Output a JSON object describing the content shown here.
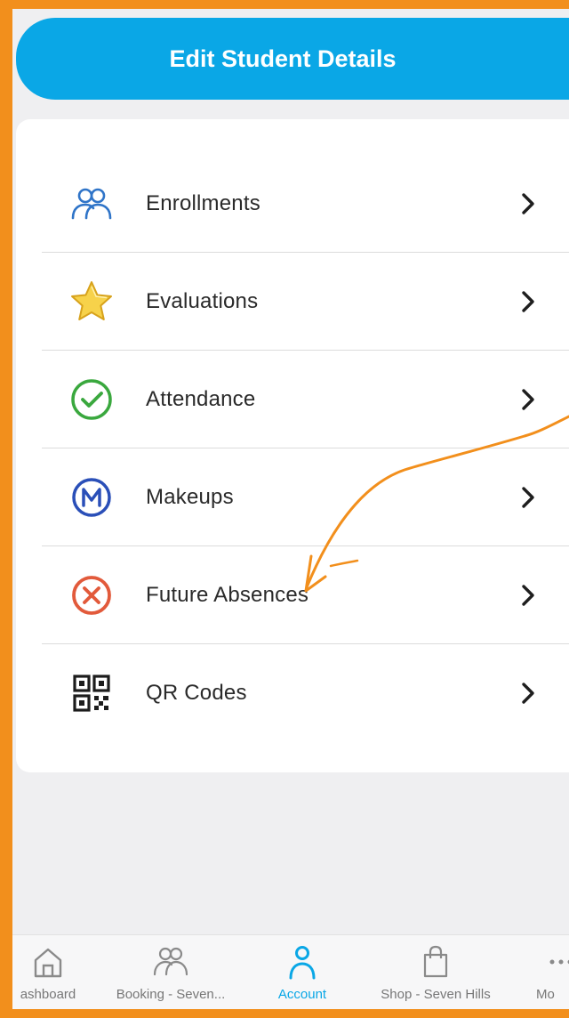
{
  "header": {
    "title": "Edit Student Details"
  },
  "menu": {
    "items": [
      {
        "label": "Enrollments",
        "icon": "people-icon"
      },
      {
        "label": "Evaluations",
        "icon": "star-icon"
      },
      {
        "label": "Attendance",
        "icon": "check-circle-icon"
      },
      {
        "label": "Makeups",
        "icon": "makeup-m-icon"
      },
      {
        "label": "Future Absences",
        "icon": "x-circle-icon"
      },
      {
        "label": "QR Codes",
        "icon": "qr-code-icon"
      }
    ]
  },
  "tabbar": {
    "tabs": [
      {
        "label": "ashboard",
        "icon": "home-icon",
        "active": false
      },
      {
        "label": "Booking - Seven...",
        "icon": "people-icon",
        "active": false
      },
      {
        "label": "Account",
        "icon": "person-icon",
        "active": true
      },
      {
        "label": "Shop - Seven Hills",
        "icon": "shopping-bag-icon",
        "active": false
      },
      {
        "label": "Mo",
        "icon": "more-icon",
        "active": false
      }
    ]
  },
  "colors": {
    "accent": "#0aa7e6",
    "frame": "#f28f1c",
    "background": "#efeff1"
  }
}
